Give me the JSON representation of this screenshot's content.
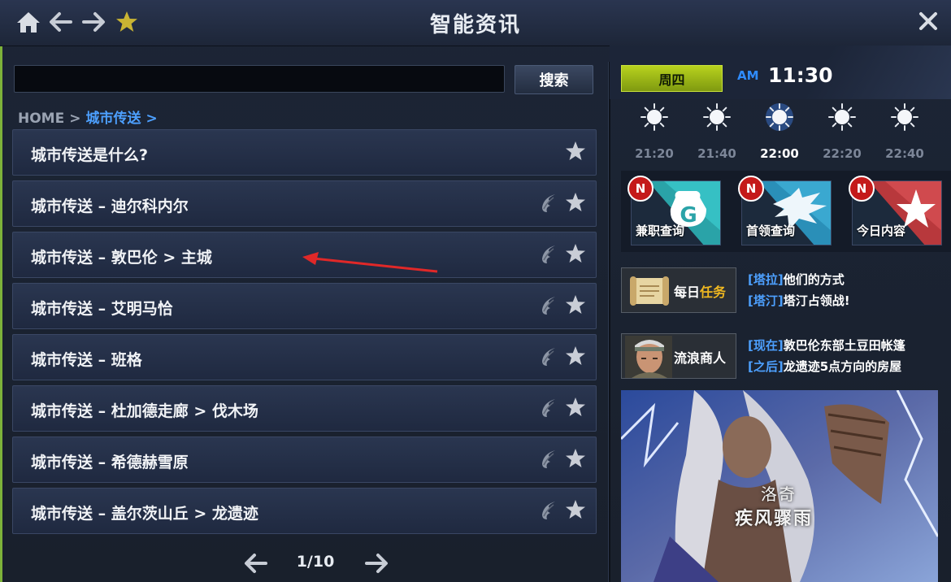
{
  "window": {
    "title": "智能资讯",
    "icons": [
      "home-icon",
      "back-icon",
      "forward-icon",
      "favorite-star-icon",
      "close-icon"
    ]
  },
  "search": {
    "value": "",
    "placeholder": "",
    "button_label": "搜索"
  },
  "breadcrumb": {
    "home": "HOME",
    "separator": ">",
    "current": "城市传送",
    "trailing": ">"
  },
  "list": {
    "items": [
      {
        "label": "城市传送是什么?",
        "has_wing": false
      },
      {
        "label": "城市传送 – 迪尔科内尔",
        "has_wing": true
      },
      {
        "label": "城市传送 – 敦巴伦 > 主城",
        "has_wing": true
      },
      {
        "label": "城市传送 – 艾明马恰",
        "has_wing": true
      },
      {
        "label": "城市传送 – 班格",
        "has_wing": true
      },
      {
        "label": "城市传送 – 杜加德走廊 > 伐木场",
        "has_wing": true
      },
      {
        "label": "城市传送 – 希德赫雪原",
        "has_wing": true
      },
      {
        "label": "城市传送 – 盖尔茨山丘 > 龙遗迹",
        "has_wing": true
      }
    ]
  },
  "pager": {
    "current_text": "1/10"
  },
  "clock": {
    "day": "周四",
    "ampm": "AM",
    "time": "11:30"
  },
  "weather": {
    "slots": [
      {
        "time": "21:20",
        "active": false
      },
      {
        "time": "21:40",
        "active": false
      },
      {
        "time": "22:00",
        "active": true
      },
      {
        "time": "22:20",
        "active": false
      },
      {
        "time": "22:40",
        "active": false
      }
    ]
  },
  "tiles": [
    {
      "label": "兼职查询",
      "badge": "N"
    },
    {
      "label": "首领查询",
      "badge": "N"
    },
    {
      "label": "今日内容",
      "badge": "N"
    }
  ],
  "daily_quest": {
    "title_white": "每日",
    "title_yellow": "任务",
    "lines": [
      {
        "tag": "[塔拉]",
        "text": "他们的方式"
      },
      {
        "tag": "[塔汀]",
        "text": "塔汀占领战!"
      }
    ]
  },
  "merchant": {
    "title": "流浪商人",
    "lines": [
      {
        "tag": "[现在]",
        "text": "敦巴伦东部土豆田帐篷"
      },
      {
        "tag": "[之后]",
        "text": "龙遗迹5点方向的房屋"
      }
    ]
  },
  "banner": {
    "caption1": "洛奇",
    "caption2": "疾风骤雨"
  },
  "colors": {
    "accent_blue": "#4da0ff",
    "day_green": "#a5c21a",
    "badge_red": "#c41a1a",
    "quest_yellow": "#f0b820"
  }
}
